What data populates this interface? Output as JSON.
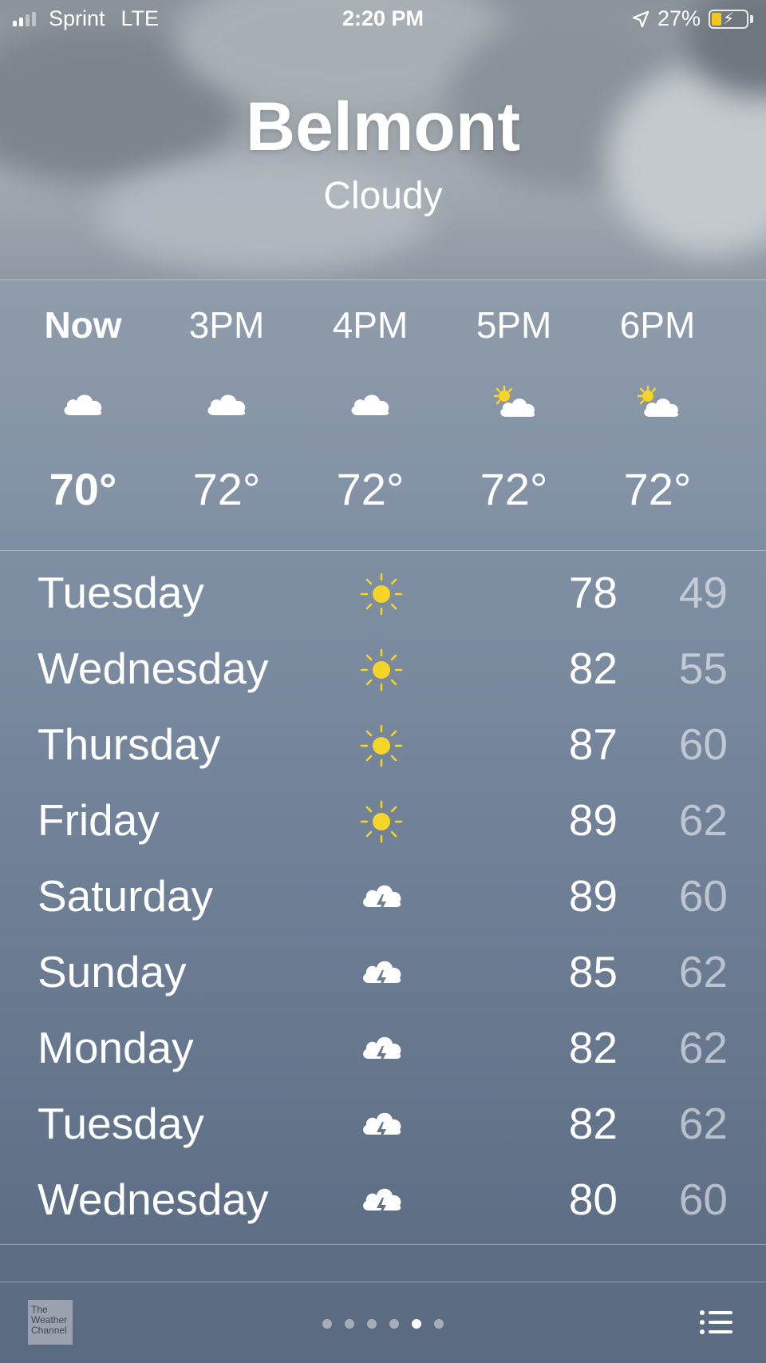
{
  "status_bar": {
    "carrier": "Sprint",
    "network": "LTE",
    "time": "2:20 PM",
    "battery": "27%",
    "icons": [
      "signal-icon",
      "location-arrow-icon",
      "battery-charging-icon"
    ]
  },
  "location": {
    "city": "Belmont",
    "condition": "Cloudy"
  },
  "hourly": [
    {
      "label": "Now",
      "icon": "cloud-icon",
      "temp": "70°"
    },
    {
      "label": "3PM",
      "icon": "cloud-icon",
      "temp": "72°"
    },
    {
      "label": "4PM",
      "icon": "cloud-icon",
      "temp": "72°"
    },
    {
      "label": "5PM",
      "icon": "partly-sunny-icon",
      "temp": "72°"
    },
    {
      "label": "6PM",
      "icon": "partly-sunny-icon",
      "temp": "72°"
    }
  ],
  "daily": [
    {
      "day": "Tuesday",
      "icon": "sun-icon",
      "high": "78",
      "low": "49"
    },
    {
      "day": "Wednesday",
      "icon": "sun-icon",
      "high": "82",
      "low": "55"
    },
    {
      "day": "Thursday",
      "icon": "sun-icon",
      "high": "87",
      "low": "60"
    },
    {
      "day": "Friday",
      "icon": "sun-icon",
      "high": "89",
      "low": "62"
    },
    {
      "day": "Saturday",
      "icon": "thunderstorm-icon",
      "high": "89",
      "low": "60"
    },
    {
      "day": "Sunday",
      "icon": "thunderstorm-icon",
      "high": "85",
      "low": "62"
    },
    {
      "day": "Monday",
      "icon": "thunderstorm-icon",
      "high": "82",
      "low": "62"
    },
    {
      "day": "Tuesday",
      "icon": "thunderstorm-icon",
      "high": "82",
      "low": "62"
    },
    {
      "day": "Wednesday",
      "icon": "thunderstorm-icon",
      "high": "80",
      "low": "60"
    }
  ],
  "footer": {
    "logo_text": "The Weather Channel",
    "page_count": 6,
    "active_page": 5
  },
  "colors": {
    "sun": "#f7d428",
    "low_temp": "#b8c0ca",
    "battery_fill": "#f5c518"
  }
}
